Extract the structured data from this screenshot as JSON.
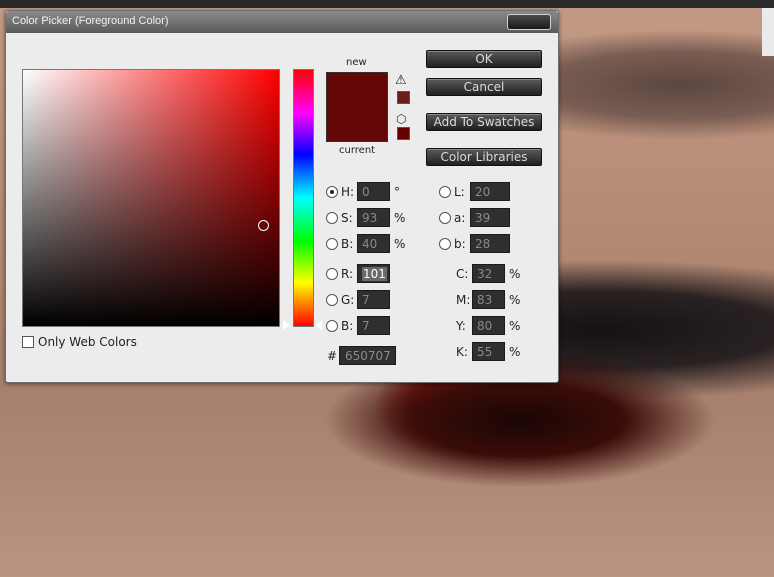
{
  "dialog": {
    "title": "Color Picker (Foreground Color)",
    "label_new": "new",
    "label_current": "current",
    "only_web_colors": "Only Web Colors",
    "new_color": "#650707",
    "current_color": "#650707",
    "gamut_warning_color": "#6b1d1b",
    "web_safe_color": "#660000"
  },
  "buttons": {
    "ok": "OK",
    "cancel": "Cancel",
    "add_to_swatches": "Add To Swatches",
    "color_libraries": "Color Libraries"
  },
  "hsb": {
    "h_label": "H:",
    "h_value": "0",
    "h_unit": "°",
    "s_label": "S:",
    "s_value": "93",
    "s_unit": "%",
    "b_label": "B:",
    "b_value": "40",
    "b_unit": "%"
  },
  "rgb": {
    "r_label": "R:",
    "r_value": "101",
    "g_label": "G:",
    "g_value": "7",
    "b_label": "B:",
    "b_value": "7"
  },
  "lab": {
    "l_label": "L:",
    "l_value": "20",
    "a_label": "a:",
    "a_value": "39",
    "b_label": "b:",
    "b_value": "28"
  },
  "cmyk": {
    "c_label": "C:",
    "c_value": "32",
    "m_label": "M:",
    "m_value": "83",
    "y_label": "Y:",
    "y_value": "80",
    "k_label": "K:",
    "k_value": "55",
    "unit": "%"
  },
  "hex": {
    "label": "#",
    "value": "650707"
  },
  "icons": {
    "gamut_warning": "warning-triangle-icon",
    "web_safe": "cube-icon",
    "close": "close-icon"
  }
}
